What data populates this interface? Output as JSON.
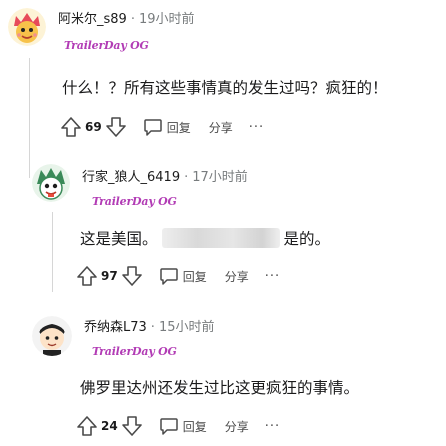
{
  "comments": [
    {
      "username": "阿米尔_s89",
      "separator": "·",
      "time": "19小时前",
      "flair": "TrailerDay OG",
      "body": "什么！？所有这些事情真的发生过吗？疯狂的！",
      "score": "69",
      "reply_label": "回复",
      "share_label": "分享",
      "more_label": "···"
    },
    {
      "username": "行家_狼人_6419",
      "separator": "·",
      "time": "17小时前",
      "flair": "TrailerDay OG",
      "body_before": "这是美国。",
      "body_after": "是的。",
      "score": "97",
      "reply_label": "回复",
      "share_label": "分享",
      "more_label": "···"
    },
    {
      "username": "乔纳森L73",
      "separator": "·",
      "time": "15小时前",
      "flair": "TrailerDay OG",
      "body": "佛罗里达州还发生过比这更疯狂的事情。",
      "score": "24",
      "reply_label": "回复",
      "share_label": "分享",
      "more_label": "···"
    }
  ],
  "icons": {
    "upvote": "arrow-up-icon",
    "downvote": "arrow-down-icon",
    "reply": "speech-bubble-icon",
    "more": "ellipsis-icon"
  },
  "colors": {
    "flair": "#b23cb5",
    "text": "#1a1a1b",
    "muted": "#787c7e"
  }
}
